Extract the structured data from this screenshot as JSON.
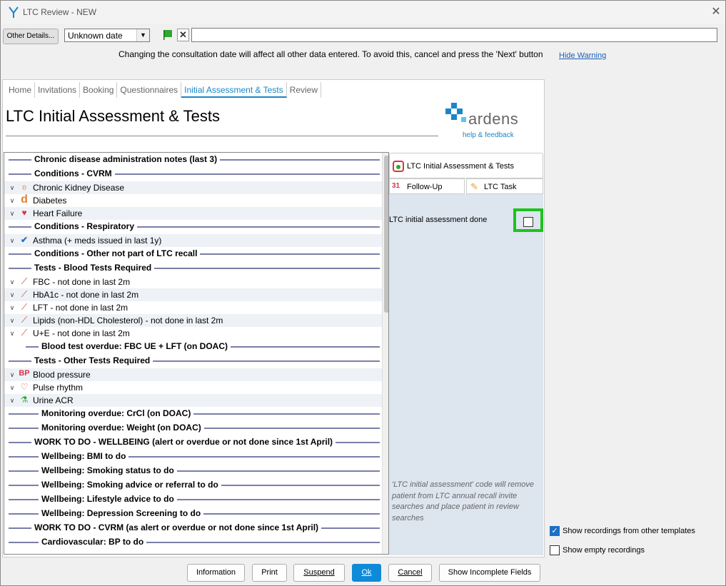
{
  "window": {
    "title": "LTC Review - NEW",
    "close": "✕"
  },
  "toolbar": {
    "other_details": "Other Details...",
    "date_value": "Unknown date",
    "notes_value": "",
    "warning": "Changing the consultation date will affect all other data entered. To avoid this, cancel and press the 'Next' button",
    "hide_warning": "Hide Warning"
  },
  "tabs": [
    {
      "label": "Home"
    },
    {
      "label": "Invitations"
    },
    {
      "label": "Booking"
    },
    {
      "label": "Questionnaires"
    },
    {
      "label": "Initial Assessment & Tests"
    },
    {
      "label": "Review"
    }
  ],
  "page": {
    "title": "LTC Initial Assessment & Tests"
  },
  "logo": {
    "text": "ardens",
    "subtext": "help & feedback"
  },
  "list": {
    "h_admin": "Chronic disease administration notes (last 3)",
    "h_cvrm": "Conditions - CVRM",
    "ckd": "Chronic Kidney Disease",
    "diabetes": "Diabetes",
    "hf": "Heart Failure",
    "h_resp": "Conditions - Respiratory",
    "asthma": "Asthma (+ meds issued in last 1y)",
    "h_other": "Conditions - Other not part of LTC recall",
    "h_blood": "Tests - Blood Tests Required",
    "fbc": "FBC - not done in last 2m",
    "hba1c": "HbA1c - not done in last 2m",
    "lft": "LFT - not done in last 2m",
    "lipids": "Lipids (non-HDL Cholesterol) - not done in last 2m",
    "ue": "U+E - not done in last 2m",
    "h_blood_overdue": "Blood test overdue: FBC UE + LFT (on DOAC)",
    "h_othertests": "Tests - Other Tests Required",
    "bp": "Blood pressure",
    "pulse": "Pulse rhythm",
    "acr": "Urine ACR",
    "h_crcl": "Monitoring overdue: CrCl (on DOAC)",
    "h_weight": "Monitoring overdue: Weight (on DOAC)",
    "h_wtd_wellbeing": "WORK TO DO - WELLBEING (alert or overdue or not done since 1st April)",
    "h_bmi": "Wellbeing: BMI to do",
    "h_smoking": "Wellbeing: Smoking status to do",
    "h_smoking_adv": "Wellbeing: Smoking advice or referral to do",
    "h_lifestyle": "Wellbeing: Lifestyle advice to do",
    "h_depression": "Wellbeing: Depression Screening to do",
    "h_wtd_cvrm": "WORK TO DO - CVRM (as alert or overdue or not done since 1st April)",
    "h_cardio_bp": "Cardiovascular: BP to do"
  },
  "side": {
    "tab_main": "LTC Initial Assessment & Tests",
    "tab_followup": "Follow-Up",
    "tab_task": "LTC Task",
    "done_label": "LTC initial assessment done",
    "note": "'LTC initial assessment' code will remove patient from LTC annual recall invite searches and place patient in review searches"
  },
  "options": {
    "show_other": "Show recordings from other templates",
    "show_empty": "Show empty recordings"
  },
  "buttons": {
    "information": "Information",
    "print": "Print",
    "suspend": "Suspend",
    "ok": "Ok",
    "cancel": "Cancel",
    "incomplete": "Show Incomplete Fields"
  },
  "icons": {
    "bp_text": "BP",
    "calendar_text": "31",
    "diabetes_text": "d"
  }
}
